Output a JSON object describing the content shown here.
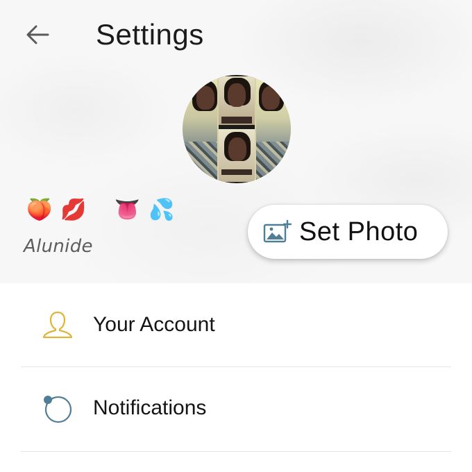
{
  "header": {
    "title": "Settings",
    "back_icon": "arrow-left-icon"
  },
  "profile": {
    "avatar_icon": "profile-photo-collage",
    "status_emojis": [
      "🍑",
      "💋",
      "👅",
      "💦"
    ],
    "username": "Alunide"
  },
  "set_photo": {
    "label": "Set Photo",
    "icon": "add-photo-icon"
  },
  "menu": {
    "items": [
      {
        "label": "Your Account",
        "icon": "user-outline-icon",
        "icon_color": "#E2B33C"
      },
      {
        "label": "Notifications",
        "icon": "notification-ring-icon",
        "icon_color": "#4E7F96"
      }
    ]
  },
  "colors": {
    "hero_background": "#F7F7F7",
    "account_icon": "#E2B33C",
    "notification_icon": "#4E7F96",
    "photo_icon": "#4E7F96"
  }
}
